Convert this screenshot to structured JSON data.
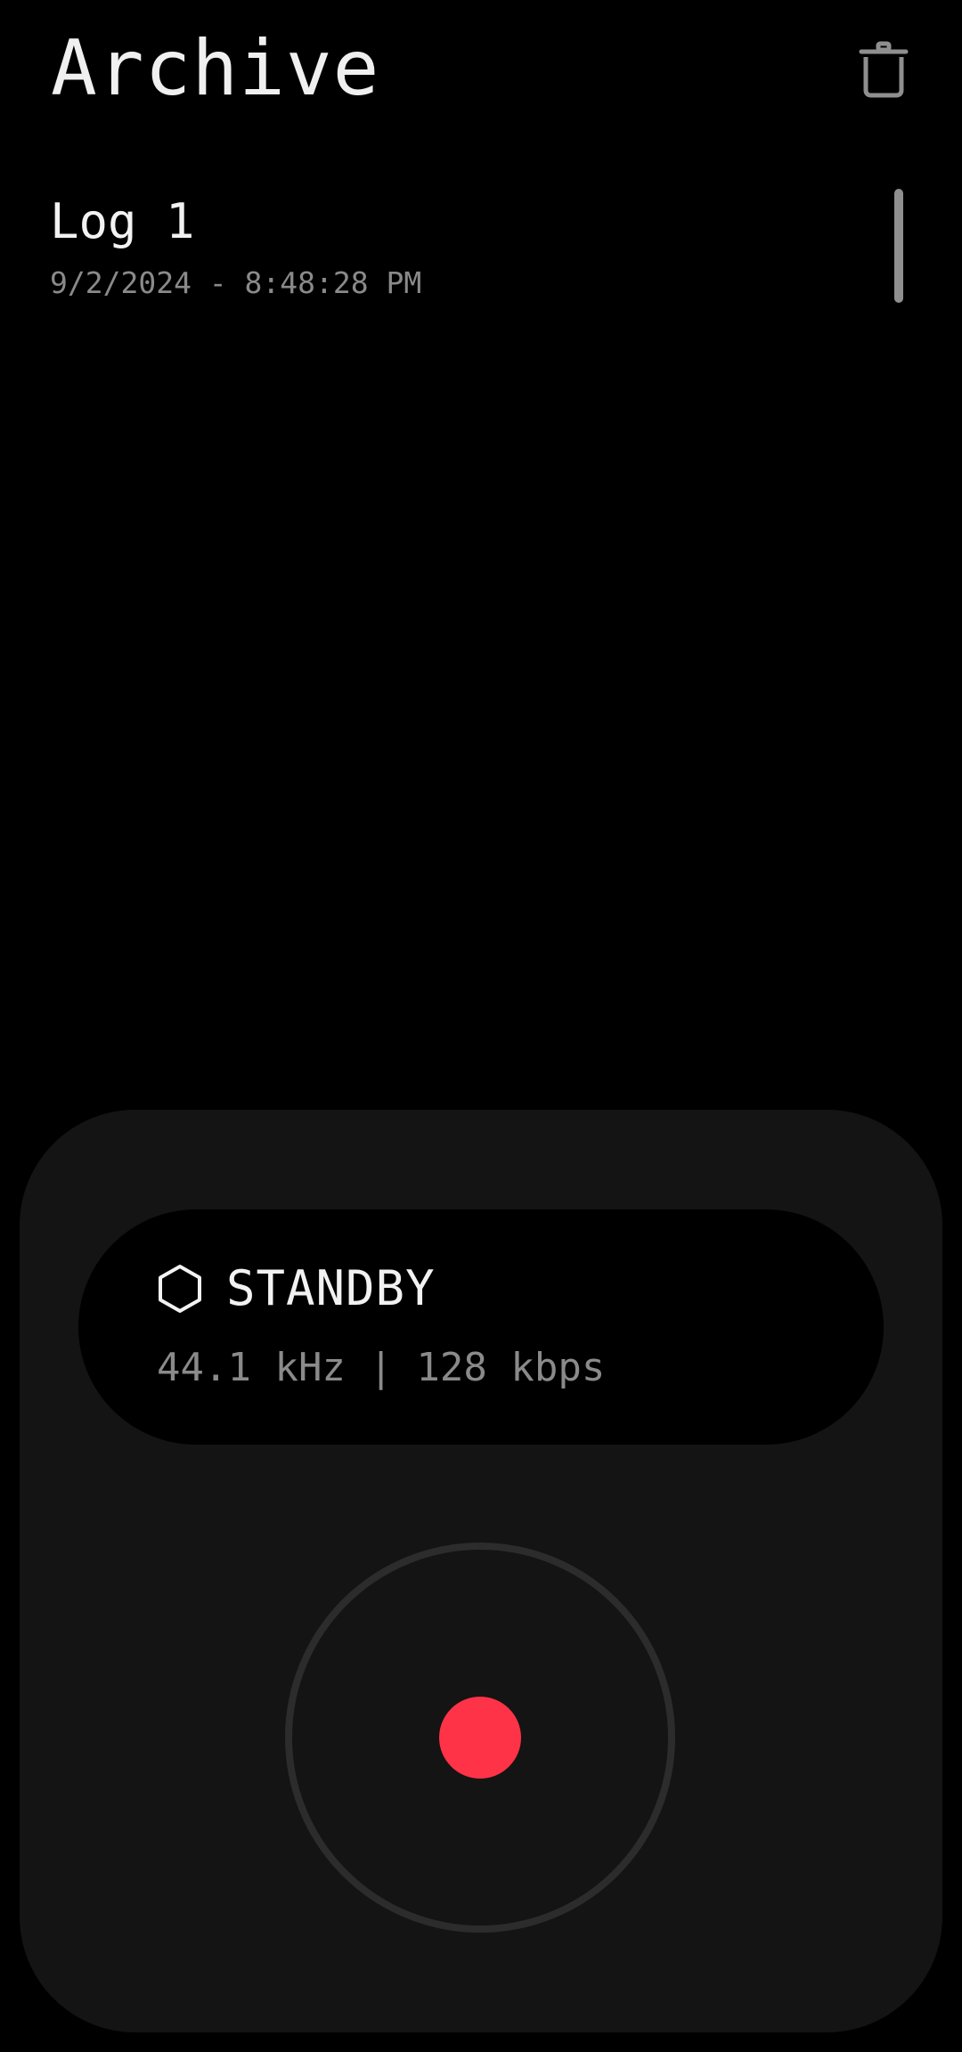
{
  "header": {
    "title": "Archive",
    "delete_icon": "trash-icon"
  },
  "logs": [
    {
      "title": "Log 1",
      "timestamp": "9/2/2024 - 8:48:28 PM"
    }
  ],
  "recorder": {
    "status_icon": "hexagon-icon",
    "status": "STANDBY",
    "audio_info": "44.1 kHz | 128 kbps",
    "record_icon": "record-dot-icon"
  },
  "colors": {
    "background": "#000000",
    "panel": "#141414",
    "ring": "#2c2c2c",
    "record": "#ff3347",
    "text_primary": "#f2f2f2",
    "text_secondary": "#8a8a8a",
    "icon_muted": "#8f8f8f"
  }
}
